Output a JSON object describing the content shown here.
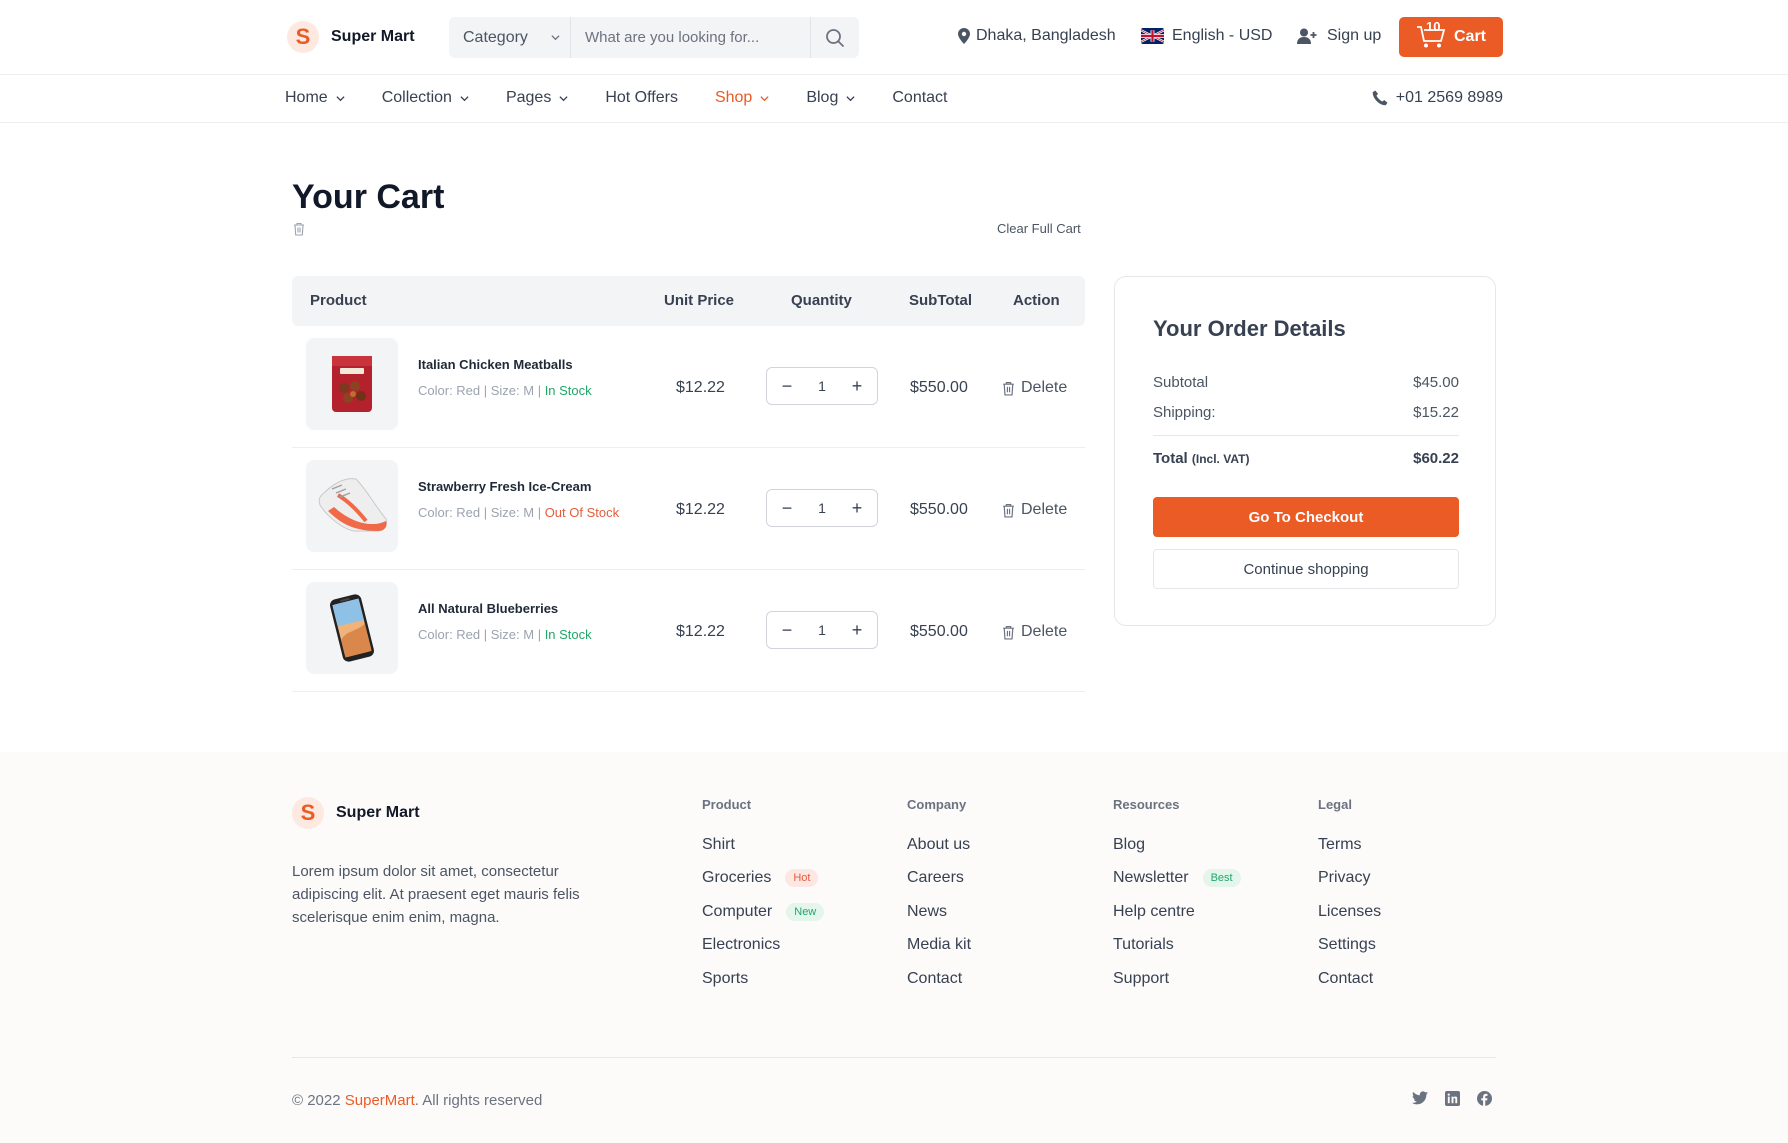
{
  "brand": {
    "name": "Super Mart",
    "initial": "S",
    "accent": "#ea5b25"
  },
  "header": {
    "category_label": "Category",
    "search_placeholder": "What are you looking for...",
    "location": "Dhaka, Bangladesh",
    "language": "English - USD",
    "signup": "Sign up",
    "cart_label": "Cart",
    "cart_count": "10"
  },
  "nav": {
    "items": [
      {
        "label": "Home",
        "has_dropdown": true
      },
      {
        "label": "Collection",
        "has_dropdown": true
      },
      {
        "label": "Pages",
        "has_dropdown": true
      },
      {
        "label": "Hot Offers",
        "has_dropdown": false
      },
      {
        "label": "Shop",
        "has_dropdown": true,
        "active": true
      },
      {
        "label": "Blog",
        "has_dropdown": true
      },
      {
        "label": "Contact",
        "has_dropdown": false
      }
    ],
    "phone": "+01 2569 8989"
  },
  "cart": {
    "title": "Your Cart",
    "clear_label": "Clear Full Cart",
    "columns": [
      "Product",
      "Unit Price",
      "Quantity",
      "SubTotal",
      "Action"
    ],
    "items": [
      {
        "name": "Italian Chicken Meatballs",
        "meta": "Color: Red | Size: M | ",
        "stock": "In Stock",
        "in_stock": true,
        "unit_price": "$12.22",
        "qty": "1",
        "subtotal": "$550.00",
        "action": "Delete",
        "image": "meatballs-pack"
      },
      {
        "name": "Strawberry Fresh Ice-Cream",
        "meta": "Color: Red | Size: M | ",
        "stock": "Out Of Stock",
        "in_stock": false,
        "unit_price": "$12.22",
        "qty": "1",
        "subtotal": "$550.00",
        "action": "Delete",
        "image": "sneaker"
      },
      {
        "name": "All Natural Blueberries",
        "meta": "Color: Red | Size: M | ",
        "stock": "In Stock",
        "in_stock": true,
        "unit_price": "$12.22",
        "qty": "1",
        "subtotal": "$550.00",
        "action": "Delete",
        "image": "smartphone"
      }
    ]
  },
  "order": {
    "title": "Your Order Details",
    "subtotal_label": "Subtotal",
    "subtotal_value": "$45.00",
    "shipping_label": "Shipping:",
    "shipping_value": "$15.22",
    "total_label": "Total",
    "total_note": "(Incl. VAT)",
    "total_value": "$60.22",
    "checkout_label": "Go To Checkout",
    "continue_label": "Continue shopping"
  },
  "footer": {
    "description": "Lorem ipsum dolor sit amet, consectetur adipiscing elit. At praesent eget mauris felis scelerisque enim enim, magna.",
    "columns": [
      {
        "title": "Product",
        "links": [
          {
            "label": "Shirt"
          },
          {
            "label": "Groceries",
            "badge": "Hot"
          },
          {
            "label": "Computer",
            "badge": "New"
          },
          {
            "label": "Electronics"
          },
          {
            "label": "Sports"
          }
        ]
      },
      {
        "title": "Company",
        "links": [
          {
            "label": "About us"
          },
          {
            "label": "Careers"
          },
          {
            "label": "News"
          },
          {
            "label": "Media kit"
          },
          {
            "label": "Contact"
          }
        ]
      },
      {
        "title": "Resources",
        "links": [
          {
            "label": "Blog"
          },
          {
            "label": "Newsletter",
            "badge": "Best"
          },
          {
            "label": "Help centre"
          },
          {
            "label": "Tutorials"
          },
          {
            "label": "Support"
          }
        ]
      },
      {
        "title": "Legal",
        "links": [
          {
            "label": "Terms"
          },
          {
            "label": "Privacy"
          },
          {
            "label": "Licenses"
          },
          {
            "label": "Settings"
          },
          {
            "label": "Contact"
          }
        ]
      }
    ],
    "copyright_prefix": "© 2022 ",
    "copyright_brand": "SuperMart",
    "copyright_suffix": ". All rights reserved",
    "social": [
      "twitter-icon",
      "linkedin-icon",
      "facebook-icon"
    ]
  }
}
